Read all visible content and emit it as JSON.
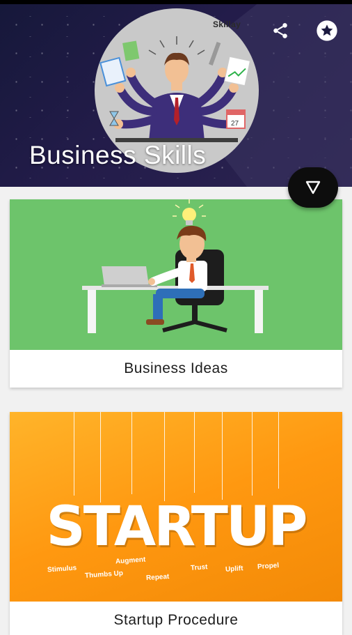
{
  "header": {
    "title": "Business Skills",
    "brand": "Skillay",
    "actions": {
      "share_icon": "share-icon",
      "favorite_icon": "star-circle-icon"
    },
    "fab_icon": "triangle-down-icon"
  },
  "cards": [
    {
      "label": "Business Ideas",
      "image": "businessman-at-desk-illustration"
    },
    {
      "label": "Startup Procedure",
      "image": "startup-hanging-letters",
      "image_word": "STARTUP",
      "tags": [
        "Stimulus",
        "Thumbs Up",
        "Augment",
        "Repeat",
        "Trust",
        "Uplift",
        "Propel"
      ]
    }
  ],
  "colors": {
    "header_bg": "#1c1b40",
    "card1_bg": "#6dc46b",
    "card2_bg": "#ff9c12",
    "fab": "#0d0d0d"
  }
}
